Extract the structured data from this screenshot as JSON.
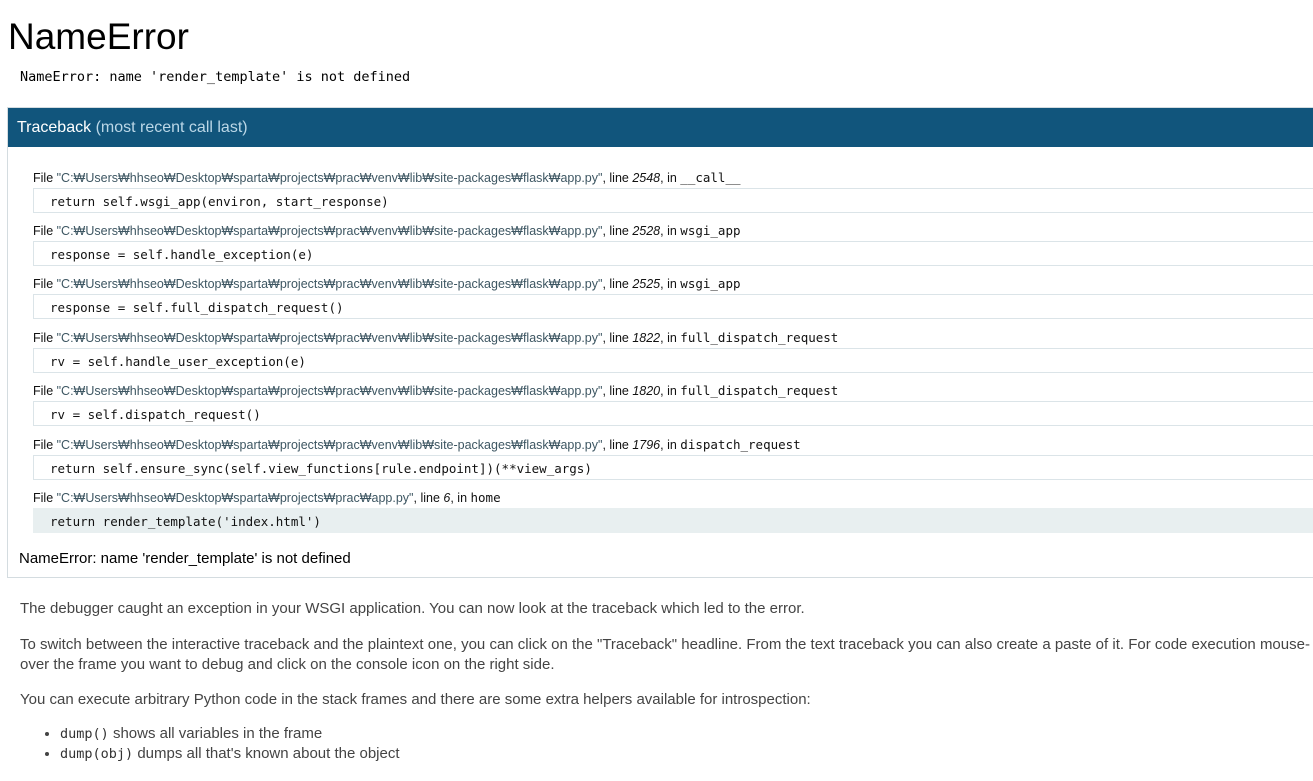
{
  "page": {
    "title": "NameError",
    "error_message": "NameError: name 'render_template' is not defined"
  },
  "traceback": {
    "heading": "Traceback",
    "heading_sub": "(most recent call last)",
    "frames": [
      {
        "file_prefix": "File ",
        "path": "\"C:₩Users₩hhseo₩Desktop₩sparta₩projects₩prac₩venv₩lib₩site-packages₩flask₩app.py\"",
        "line_label": ", line ",
        "line": "2548",
        "in_label": ", in ",
        "function": "__call__",
        "code": "return self.wsgi_app(environ, start_response)"
      },
      {
        "file_prefix": "File ",
        "path": "\"C:₩Users₩hhseo₩Desktop₩sparta₩projects₩prac₩venv₩lib₩site-packages₩flask₩app.py\"",
        "line_label": ", line ",
        "line": "2528",
        "in_label": ", in ",
        "function": "wsgi_app",
        "code": "response = self.handle_exception(e)"
      },
      {
        "file_prefix": "File ",
        "path": "\"C:₩Users₩hhseo₩Desktop₩sparta₩projects₩prac₩venv₩lib₩site-packages₩flask₩app.py\"",
        "line_label": ", line ",
        "line": "2525",
        "in_label": ", in ",
        "function": "wsgi_app",
        "code": "response = self.full_dispatch_request()"
      },
      {
        "file_prefix": "File ",
        "path": "\"C:₩Users₩hhseo₩Desktop₩sparta₩projects₩prac₩venv₩lib₩site-packages₩flask₩app.py\"",
        "line_label": ", line ",
        "line": "1822",
        "in_label": ", in ",
        "function": "full_dispatch_request",
        "code": "rv = self.handle_user_exception(e)"
      },
      {
        "file_prefix": "File ",
        "path": "\"C:₩Users₩hhseo₩Desktop₩sparta₩projects₩prac₩venv₩lib₩site-packages₩flask₩app.py\"",
        "line_label": ", line ",
        "line": "1820",
        "in_label": ", in ",
        "function": "full_dispatch_request",
        "code": "rv = self.dispatch_request()"
      },
      {
        "file_prefix": "File ",
        "path": "\"C:₩Users₩hhseo₩Desktop₩sparta₩projects₩prac₩venv₩lib₩site-packages₩flask₩app.py\"",
        "line_label": ", line ",
        "line": "1796",
        "in_label": ", in ",
        "function": "dispatch_request",
        "code": "return self.ensure_sync(self.view_functions[rule.endpoint])(**view_args)"
      },
      {
        "file_prefix": "File ",
        "path": "\"C:₩Users₩hhseo₩Desktop₩sparta₩projects₩prac₩app.py\"",
        "line_label": ", line ",
        "line": "6",
        "in_label": ", in ",
        "function": "home",
        "code": "return render_template('index.html')"
      }
    ],
    "final_error": "NameError: name 'render_template' is not defined"
  },
  "explanation": {
    "p1": "The debugger caught an exception in your WSGI application. You can now look at the traceback which led to the error.",
    "p2": "To switch between the interactive traceback and the plaintext one, you can click on the \"Traceback\" headline. From the text traceback you can also create a paste of it. For code execution mouse-over the frame you want to debug and click on the console icon on the right side.",
    "p3": "You can execute arbitrary Python code in the stack frames and there are some extra helpers available for introspection:",
    "helpers": [
      {
        "code": "dump()",
        "text": " shows all variables in the frame"
      },
      {
        "code": "dump(obj)",
        "text": " dumps all that's known about the object"
      }
    ]
  },
  "colors": {
    "header_bg": "#11557c",
    "header_sub": "#bbd7e7",
    "current_frame_bg": "#e8eff0"
  }
}
